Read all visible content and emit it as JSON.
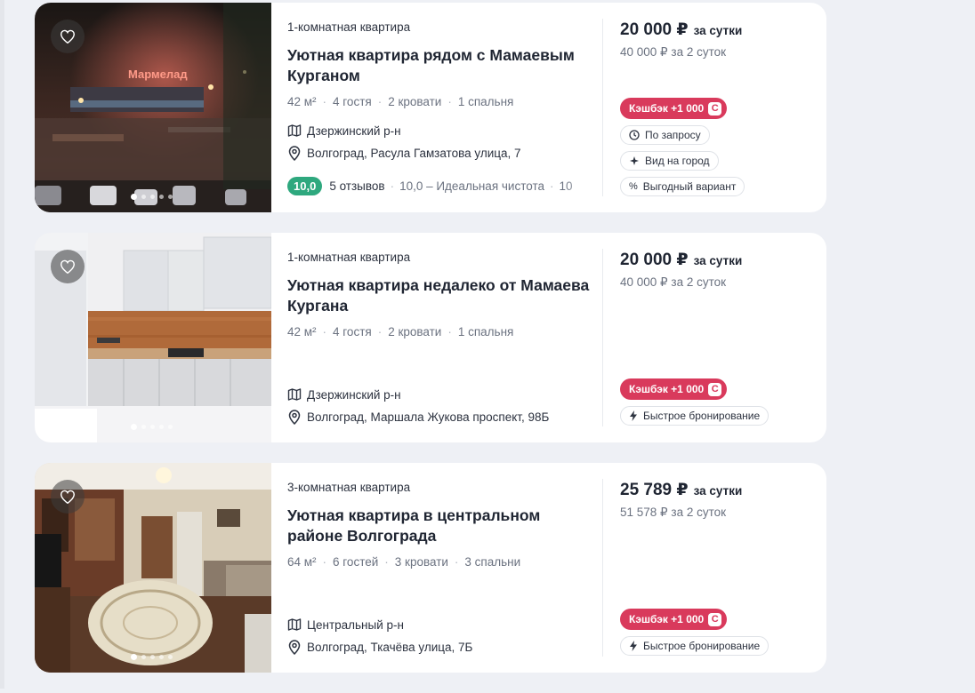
{
  "listings": [
    {
      "type": "1-комнатная квартира",
      "title": "Уютная квартира рядом с Мамаевым Курганом",
      "area": "42 м²",
      "guests": "4 гостя",
      "beds": "2 кровати",
      "bedrooms": "1 спальня",
      "district": "Дзержинский р-н",
      "address": "Волгоград, Расула Гамзатова улица, 7",
      "rating": "10,0",
      "reviews": "5 отзывов",
      "rating_category": "10,0 – Идеальная чистота",
      "rating_category_more": "10",
      "price": "20 000 ₽",
      "price_per": "за сутки",
      "price_total": "40 000 ₽ за 2 суток",
      "cashback": "Кэшбэк +1 000",
      "tags": [
        "По запросу",
        "Вид на город",
        "Выгодный вариант"
      ],
      "tag_icons": [
        "clock-icon",
        "sparkle-icon",
        "percent-icon"
      ],
      "photo_text": "Мармелад"
    },
    {
      "type": "1-комнатная квартира",
      "title": "Уютная квартира недалеко от Мамаева Кургана",
      "area": "42 м²",
      "guests": "4 гостя",
      "beds": "2 кровати",
      "bedrooms": "1 спальня",
      "district": "Дзержинский р-н",
      "address": "Волгоград, Маршала Жукова проспект, 98Б",
      "price": "20 000 ₽",
      "price_per": "за сутки",
      "price_total": "40 000 ₽ за 2 суток",
      "cashback": "Кэшбэк +1 000",
      "tags": [
        "Быстрое бронирование"
      ],
      "tag_icons": [
        "lightning-icon"
      ]
    },
    {
      "type": "3-комнатная квартира",
      "title": "Уютная квартира в центральном районе Волгограда",
      "area": "64 м²",
      "guests": "6 гостей",
      "beds": "3 кровати",
      "bedrooms": "3 спальни",
      "district": "Центральный р-н",
      "address": "Волгоград, Ткачёва улица, 7Б",
      "price": "25 789 ₽",
      "price_per": "за сутки",
      "price_total": "51 578 ₽ за 2 суток",
      "cashback": "Кэшбэк +1 000",
      "tags": [
        "Быстрое бронирование"
      ],
      "tag_icons": [
        "lightning-icon"
      ]
    }
  ],
  "colors": {
    "rating_green": "#2ea87e",
    "cashback_red": "#d93a5c",
    "page_bg": "#eef0f5"
  }
}
